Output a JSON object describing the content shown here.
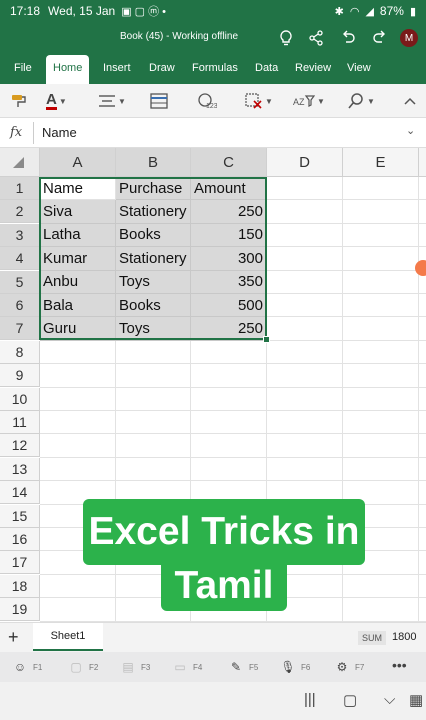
{
  "status": {
    "time": "17:18",
    "date": "Wed, 15 Jan",
    "battery": "87%"
  },
  "app": {
    "title": "Book (45) - Working offline",
    "avatar": "M"
  },
  "tabs": [
    "File",
    "Home",
    "Insert",
    "Draw",
    "Formulas",
    "Data",
    "Review",
    "View"
  ],
  "active_tab": "Home",
  "ribbon": [
    {
      "name": "format-painter-icon",
      "glyph": "🖌"
    },
    {
      "name": "font-color-icon",
      "glyph": "A"
    },
    {
      "name": "align-icon",
      "glyph": "≡"
    },
    {
      "name": "table-icon",
      "glyph": "▦"
    },
    {
      "name": "number-format-icon",
      "glyph": "123"
    },
    {
      "name": "clear-icon",
      "glyph": "✖"
    },
    {
      "name": "sort-filter-icon",
      "glyph": "⇅"
    },
    {
      "name": "find-icon",
      "glyph": "⚲"
    },
    {
      "name": "collapse-ribbon-icon",
      "glyph": "^"
    }
  ],
  "formula_bar": {
    "fx": "fx",
    "value": "Name"
  },
  "columns": [
    "A",
    "B",
    "C",
    "D",
    "E"
  ],
  "rows": [
    "1",
    "2",
    "3",
    "4",
    "5",
    "6",
    "7",
    "8",
    "9",
    "10",
    "11",
    "12",
    "13",
    "14",
    "15",
    "16",
    "17",
    "18",
    "19"
  ],
  "table": [
    [
      "Name",
      "Purchase",
      "Amount"
    ],
    [
      "Siva",
      "Stationery",
      "250"
    ],
    [
      "Latha",
      "Books",
      "150"
    ],
    [
      "Kumar",
      "Stationery",
      "300"
    ],
    [
      "Anbu",
      "Toys",
      "350"
    ],
    [
      "Bala",
      "Books",
      "500"
    ],
    [
      "Guru",
      "Toys",
      "250"
    ]
  ],
  "overlay": {
    "line1": "Excel Tricks in",
    "line2": "Tamil"
  },
  "sheet": {
    "add": "+",
    "name": "Sheet1",
    "sum_label": "SUM",
    "sum_value": "1800"
  },
  "function_keys": [
    "F1",
    "F2",
    "F3",
    "F4",
    "F5",
    "F6",
    "F7"
  ],
  "colors": {
    "brand": "#217346",
    "overlay": "#2cb24b",
    "selection": "#d9d9d9"
  }
}
